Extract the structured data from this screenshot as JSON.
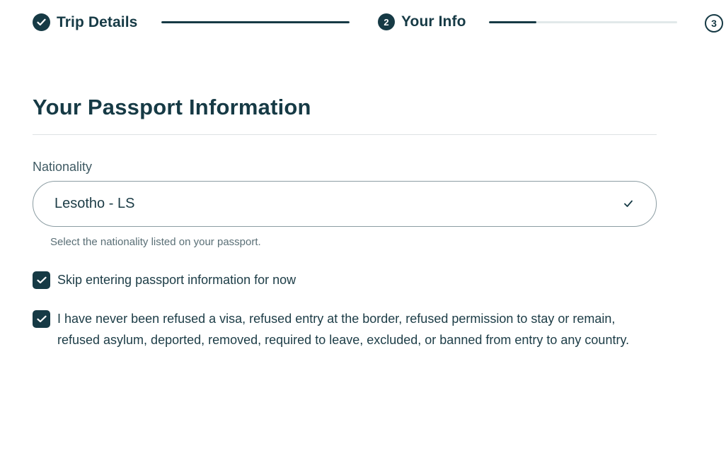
{
  "stepper": {
    "steps": [
      {
        "number": "",
        "label": "Trip Details",
        "state": "complete"
      },
      {
        "number": "2",
        "label": "Your Info",
        "state": "active"
      },
      {
        "number": "3",
        "label": "",
        "state": "upcoming"
      }
    ],
    "connector_progress": [
      1.0,
      0.25
    ]
  },
  "page": {
    "title": "Your Passport Information"
  },
  "nationality": {
    "label": "Nationality",
    "value": "Lesotho - LS",
    "help_text": "Select the nationality listed on your passport."
  },
  "options": {
    "skip_passport": {
      "label": "Skip entering passport information for now",
      "checked": true
    },
    "declaration": {
      "label": "I have never been refused a visa, refused entry at the border, refused permission to stay or remain, refused asylum, deported, removed, required to leave, excluded, or banned from entry to any country.",
      "checked": true
    }
  },
  "colors": {
    "primary": "#163a45",
    "track": "#e1e9ea",
    "border": "#8c9da3"
  },
  "icons": [
    "check-icon",
    "chevron-check-icon"
  ]
}
